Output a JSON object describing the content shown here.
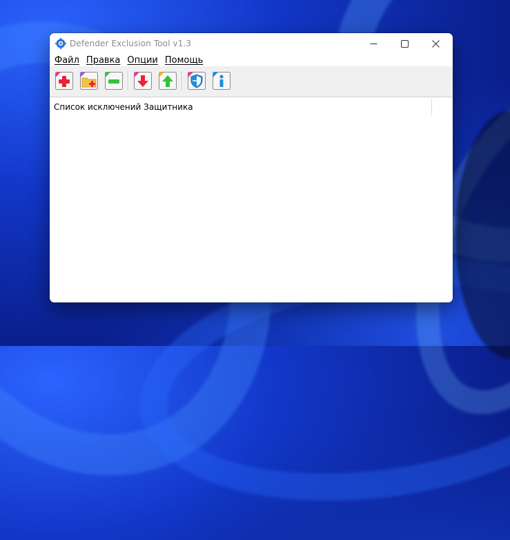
{
  "window": {
    "title": "Defender Exclusion Tool v1.3"
  },
  "menu": [
    {
      "label": "Файл"
    },
    {
      "label": "Правка"
    },
    {
      "label": "Опции"
    },
    {
      "label": "Помощь"
    }
  ],
  "toolbar": {
    "buttons": [
      {
        "icon": "add-icon"
      },
      {
        "icon": "add-folder-icon"
      },
      {
        "icon": "remove-icon"
      },
      {
        "icon": "import-icon"
      },
      {
        "icon": "export-icon"
      },
      {
        "icon": "defender-shield-icon"
      },
      {
        "icon": "info-icon"
      }
    ]
  },
  "list": {
    "column_header": "Список исключений Защитника"
  },
  "colors": {
    "accent_red": "#e8233a",
    "accent_green": "#35c23b",
    "accent_blue": "#1a8fe0"
  }
}
